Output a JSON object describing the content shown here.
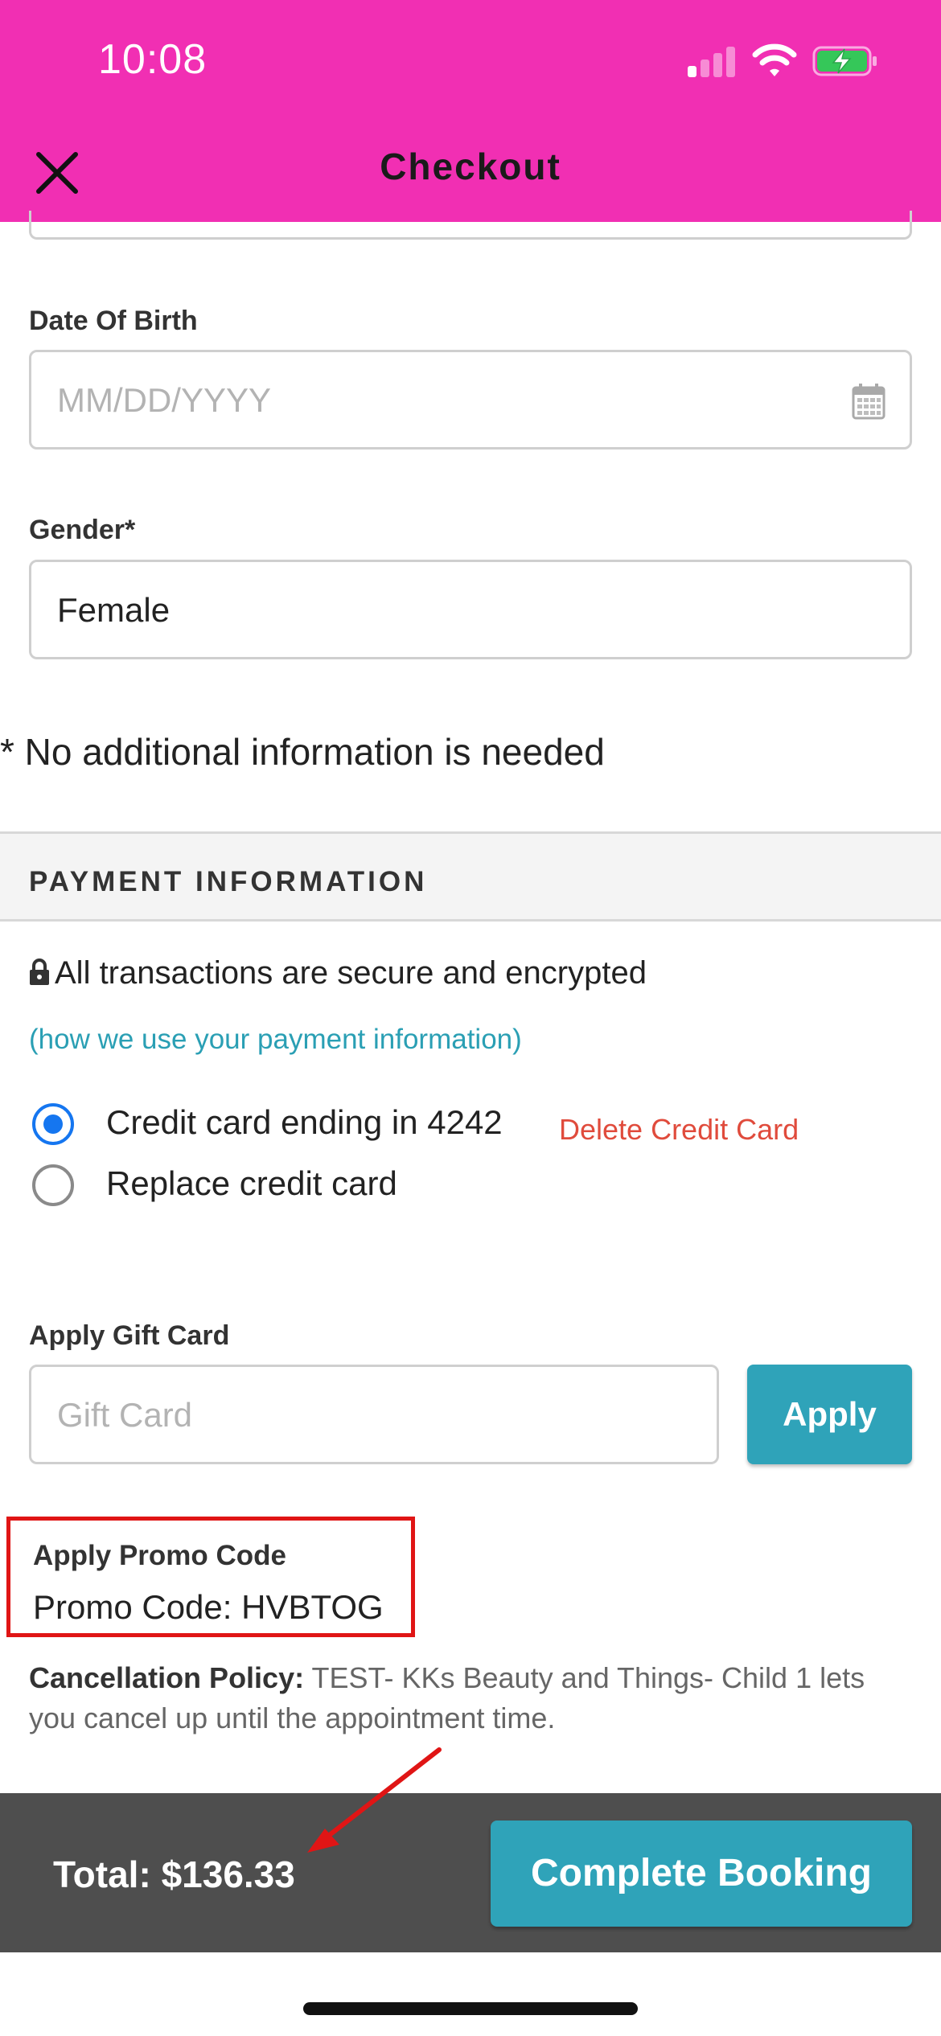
{
  "status_bar": {
    "time": "10:08",
    "signal_icon": "cellular-signal-icon",
    "wifi_icon": "wifi-icon",
    "battery_icon": "battery-charging-icon"
  },
  "header": {
    "title": "Checkout",
    "close_icon": "close-icon",
    "background_color": "#f12fb3"
  },
  "form": {
    "dob": {
      "label": "Date Of Birth",
      "placeholder": "MM/DD/YYYY",
      "value": "",
      "icon": "calendar-icon"
    },
    "gender": {
      "label": "Gender*",
      "value": "Female"
    },
    "note": "* No additional information is needed"
  },
  "payment": {
    "section_title": "PAYMENT INFORMATION",
    "secure_text": "All transactions are secure and encrypted",
    "lock_icon": "lock-icon",
    "info_link": "(how we use your payment information)",
    "options": [
      {
        "label": "Credit card ending in 4242",
        "selected": true
      },
      {
        "label": "Replace credit card",
        "selected": false
      }
    ],
    "delete_link": "Delete Credit Card"
  },
  "gift_card": {
    "label": "Apply Gift Card",
    "placeholder": "Gift Card",
    "button": "Apply"
  },
  "promo": {
    "label": "Apply Promo Code",
    "code_text": "Promo Code: HVBTOG"
  },
  "policy": {
    "title": "Cancellation Policy:",
    "text": "TEST- KKs Beauty and Things- Child 1 lets you cancel up until the appointment time."
  },
  "footer": {
    "total": "Total: $136.33",
    "button": "Complete Booking"
  },
  "colors": {
    "accent": "#2fa3b9",
    "brand": "#f12fb3",
    "link": "#2a9fb4",
    "danger": "#e04b3c",
    "annotation": "#e01515"
  }
}
